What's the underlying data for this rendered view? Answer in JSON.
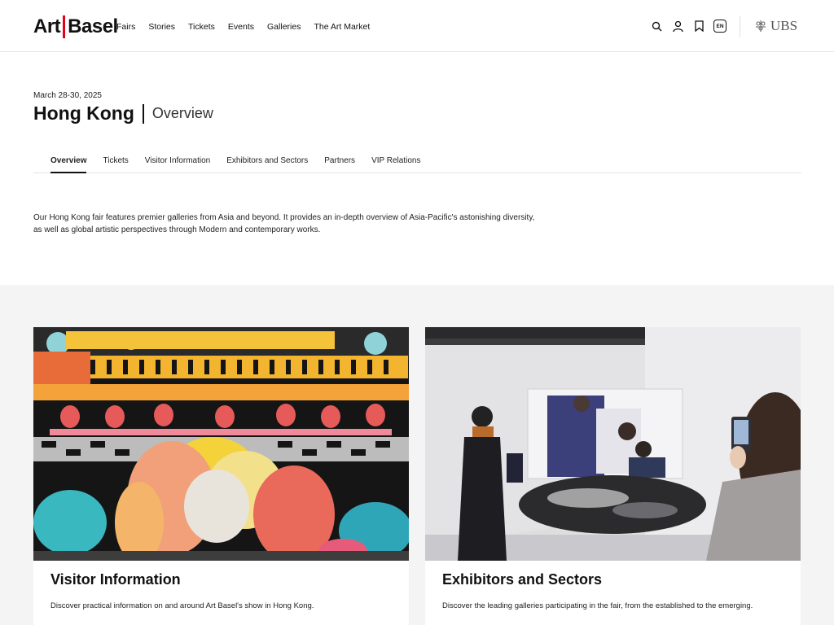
{
  "header": {
    "logo_left": "Art",
    "logo_right": "Basel",
    "nav": [
      "Fairs",
      "Stories",
      "Tickets",
      "Events",
      "Galleries",
      "The Art Market"
    ],
    "lang": "EN",
    "sponsor": "UBS",
    "icons": [
      "search-icon",
      "account-icon",
      "bookmark-icon",
      "language-icon"
    ]
  },
  "fair": {
    "date": "March 28-30, 2025",
    "city": "Hong Kong",
    "section": "Overview"
  },
  "tabs": [
    "Overview",
    "Tickets",
    "Visitor Information",
    "Exhibitors and Sectors",
    "Partners",
    "VIP Relations"
  ],
  "active_tab": "Overview",
  "intro": "Our Hong Kong fair features premier galleries from Asia and beyond. It provides an in-depth overview of Asia-Pacific's astonishing diversity, as well as global artistic perspectives through Modern and contemporary works.",
  "cards": [
    {
      "title": "Visitor Information",
      "description": "Discover practical information on and around Art Basel's show in Hong Kong."
    },
    {
      "title": "Exhibitors and Sectors",
      "description": "Discover the leading galleries participating in the fair, from the established to the emerging."
    }
  ],
  "colors": {
    "brand_red": "#e2001a",
    "section_bg": "#f4f4f4"
  }
}
